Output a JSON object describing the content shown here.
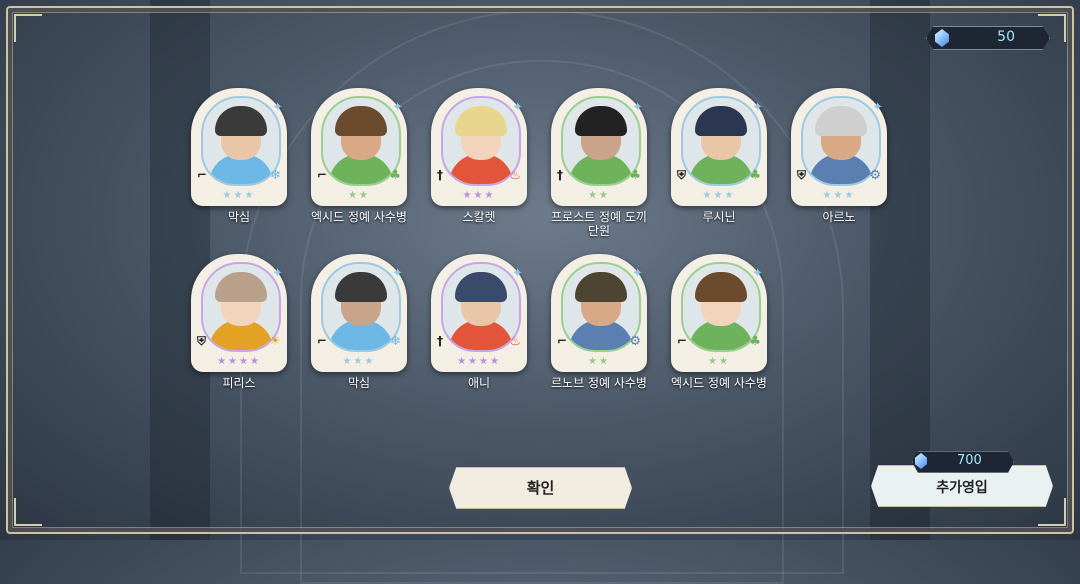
{
  "currency": {
    "icon": "blue-gem-icon",
    "amount": "50"
  },
  "cards": [
    {
      "name": "막심",
      "class_icon": "gunner-icon",
      "element_icon": "ice-icon",
      "theme": "blue",
      "stars": "★★★",
      "accent": "#6db7e6"
    },
    {
      "name": "엑시드 정예 사수병",
      "class_icon": "gunner-icon",
      "element_icon": "wood-icon",
      "theme": "green",
      "stars": "★★",
      "accent": "#6eb35c"
    },
    {
      "name": "스칼렛",
      "class_icon": "sword-icon",
      "element_icon": "fire-icon",
      "theme": "purple",
      "stars": "★★★",
      "accent": "#e2553b"
    },
    {
      "name": "프로스트 정예 도끼단원",
      "class_icon": "sword-icon",
      "element_icon": "wood-icon",
      "theme": "green",
      "stars": "★★",
      "accent": "#6eb35c"
    },
    {
      "name": "루시닌",
      "class_icon": "shield-icon",
      "element_icon": "wood-icon",
      "theme": "blue",
      "stars": "★★★",
      "accent": "#6eb35c"
    },
    {
      "name": "아르노",
      "class_icon": "shield-icon",
      "element_icon": "gear-icon",
      "theme": "blue",
      "stars": "★★★",
      "accent": "#5a7fb0"
    },
    {
      "name": "피리스",
      "class_icon": "shield-icon",
      "element_icon": "light-icon",
      "theme": "purple",
      "stars": "★★★★",
      "accent": "#e3a224"
    },
    {
      "name": "막심",
      "class_icon": "gunner-icon",
      "element_icon": "ice-icon",
      "theme": "blue",
      "stars": "★★★",
      "accent": "#6db7e6"
    },
    {
      "name": "애니",
      "class_icon": "sword-icon",
      "element_icon": "fire-icon",
      "theme": "purple",
      "stars": "★★★★",
      "accent": "#e2553b"
    },
    {
      "name": "르노브 정예 사수병",
      "class_icon": "gunner-icon",
      "element_icon": "gear-icon",
      "theme": "green",
      "stars": "★★",
      "accent": "#5a7fb0"
    },
    {
      "name": "엑시드 정예 사수병",
      "class_icon": "gunner-icon",
      "element_icon": "wood-icon",
      "theme": "green",
      "stars": "★★",
      "accent": "#6eb35c"
    }
  ],
  "buttons": {
    "confirm_label": "확인",
    "recruit_label": "추가영입",
    "recruit_cost": "700"
  }
}
